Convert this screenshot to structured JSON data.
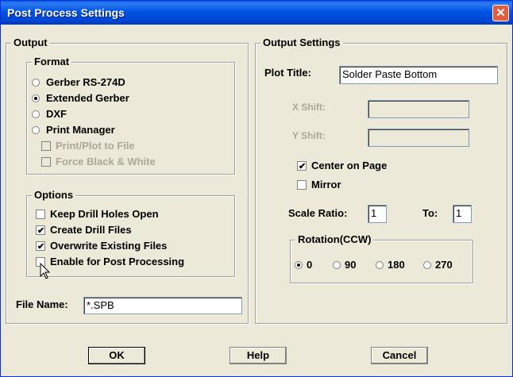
{
  "window": {
    "title": "Post Process Settings"
  },
  "output": {
    "legend": "Output",
    "format": {
      "legend": "Format",
      "options": [
        {
          "label": "Gerber RS-274D",
          "selected": false
        },
        {
          "label": "Extended Gerber",
          "selected": true
        },
        {
          "label": "DXF",
          "selected": false
        },
        {
          "label": "Print Manager",
          "selected": false
        }
      ],
      "print_to_file": {
        "label": "Print/Plot to File",
        "checked": false,
        "enabled": false
      },
      "force_bw": {
        "label": "Force Black & White",
        "checked": false,
        "enabled": false
      }
    },
    "options": {
      "legend": "Options",
      "items": [
        {
          "label": "Keep Drill Holes Open",
          "checked": false
        },
        {
          "label": "Create Drill Files",
          "checked": true
        },
        {
          "label": "Overwrite Existing Files",
          "checked": true
        },
        {
          "label": "Enable for Post Processing",
          "checked": false
        }
      ]
    },
    "file_name": {
      "label": "File Name:",
      "value": "*.SPB"
    }
  },
  "output_settings": {
    "legend": "Output Settings",
    "plot_title": {
      "label": "Plot Title:",
      "value": "Solder Paste Bottom"
    },
    "x_shift": {
      "label": "X Shift:",
      "value": ""
    },
    "y_shift": {
      "label": "Y Shift:",
      "value": ""
    },
    "center_on_page": {
      "label": "Center on Page",
      "checked": true
    },
    "mirror": {
      "label": "Mirror",
      "checked": false
    },
    "scale_ratio": {
      "label": "Scale Ratio:",
      "value": "1"
    },
    "scale_to": {
      "label": "To:",
      "value": "1"
    },
    "rotation": {
      "legend": "Rotation(CCW)",
      "options": [
        {
          "label": "0",
          "selected": true
        },
        {
          "label": "90",
          "selected": false
        },
        {
          "label": "180",
          "selected": false
        },
        {
          "label": "270",
          "selected": false
        }
      ]
    }
  },
  "buttons": {
    "ok": "OK",
    "help": "Help",
    "cancel": "Cancel"
  }
}
